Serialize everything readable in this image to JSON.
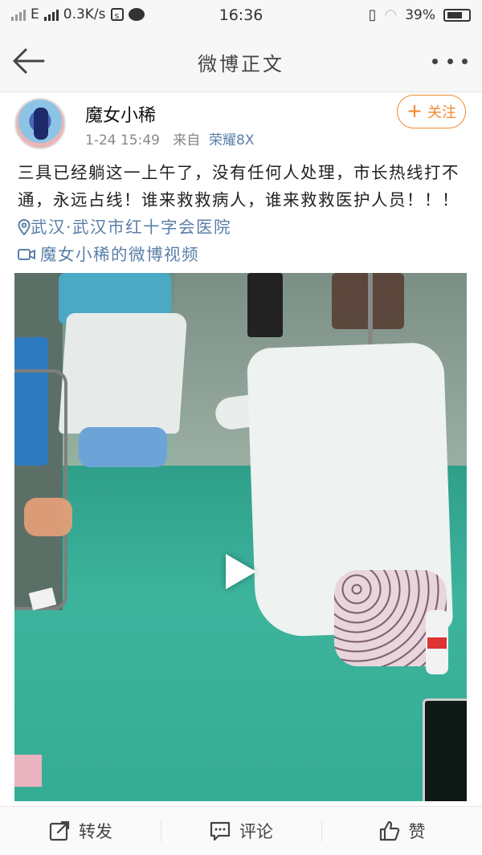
{
  "status_bar": {
    "network": "E",
    "speed": "0.3K/s",
    "time": "16:36",
    "battery": "39%"
  },
  "nav": {
    "title": "微博正文",
    "back_icon": "back-arrow-icon",
    "more_icon": "more-dots-icon"
  },
  "post": {
    "username": "魔女小稀",
    "date": "1-24 15:49",
    "from_label": "来自",
    "device": "荣耀8X",
    "follow_label": "关注",
    "text": "三具已经躺这一上午了，没有任何人处理，市长热线打不通，永远占线！谁来救救病人，谁来救救医护人员！！！",
    "location": "武汉·武汉市红十字会医院",
    "video_link": "魔女小稀的微博视频"
  },
  "toolbar": {
    "repost": "转发",
    "comment": "评论",
    "like": "赞"
  },
  "colors": {
    "accent_orange": "#f08a2c",
    "link_blue": "#5a7fa8"
  }
}
